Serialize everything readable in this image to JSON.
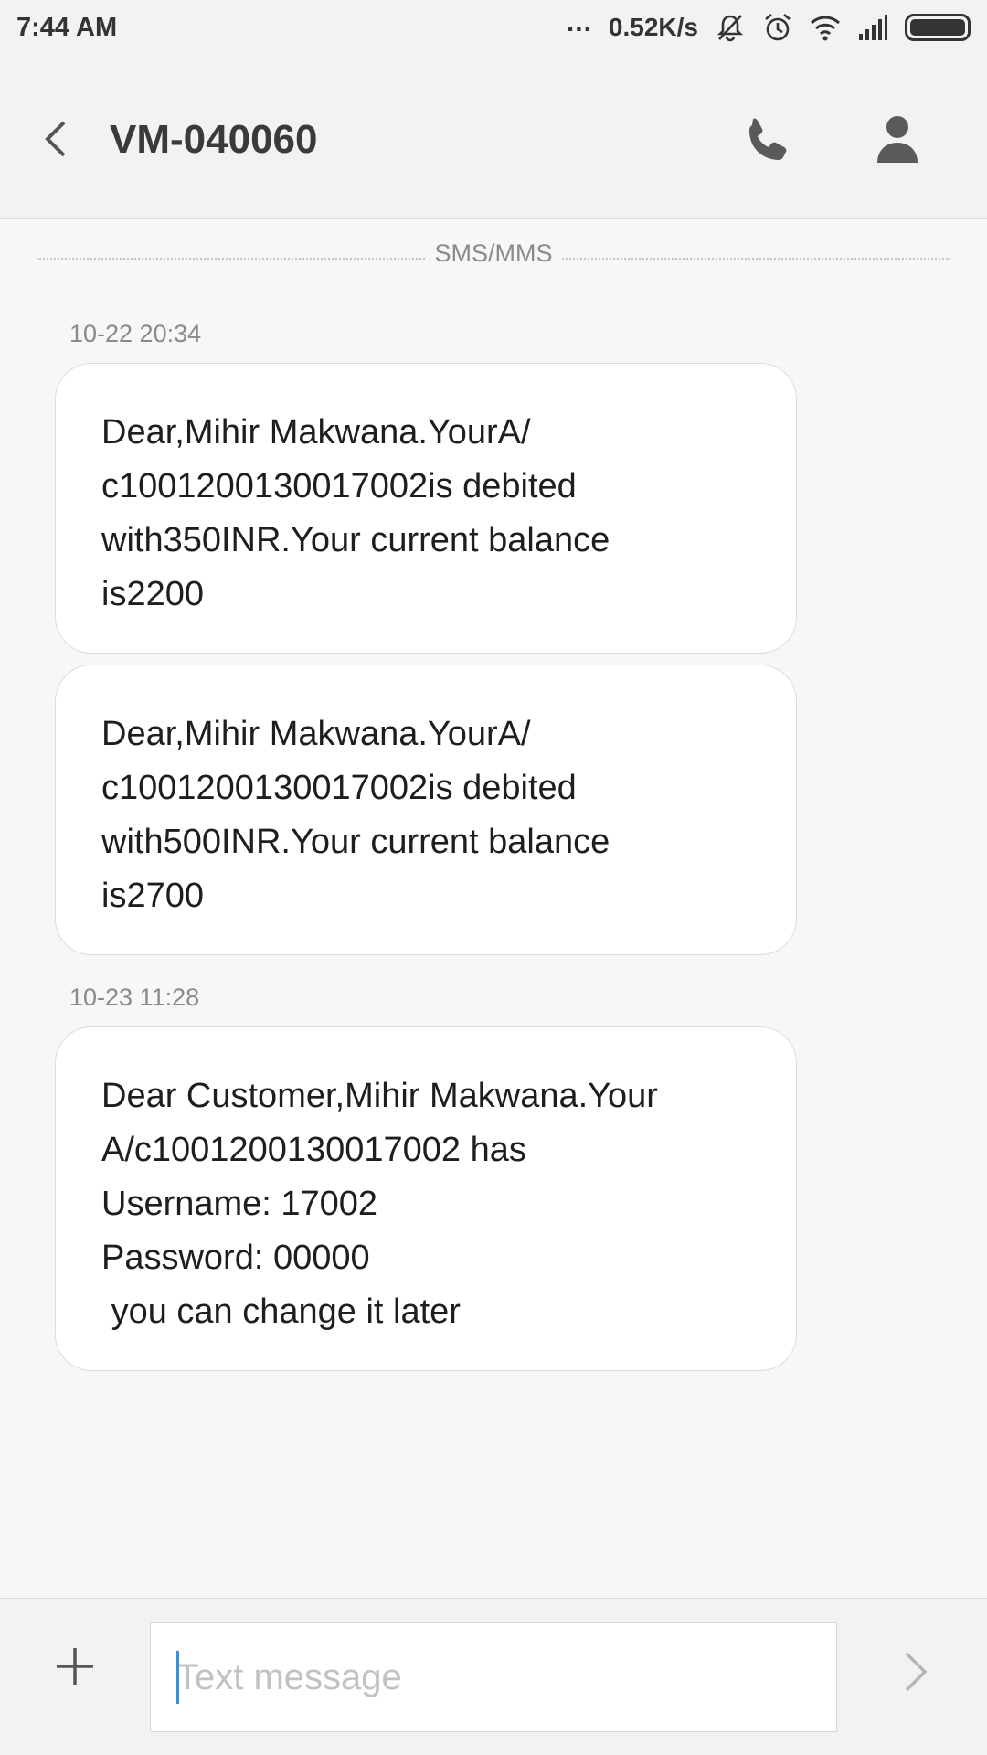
{
  "status_bar": {
    "time": "7:44 AM",
    "dots": "...",
    "speed": "0.52K/s",
    "battery_level": 1.0
  },
  "header": {
    "title": "VM-040060"
  },
  "conversation": {
    "channel_label": "SMS/MMS",
    "groups": [
      {
        "timestamp": "10-22 20:34",
        "messages": [
          "Dear,Mihir Makwana.YourA/\nc1001200130017002is debited\nwith350INR.Your current balance\nis2200",
          "Dear,Mihir Makwana.YourA/\nc1001200130017002is debited\nwith500INR.Your current balance\nis2700"
        ]
      },
      {
        "timestamp": "10-23 11:28",
        "messages": [
          "Dear Customer,Mihir Makwana.Your\nA/c1001200130017002 has\nUsername: 17002\nPassword: 00000\n you can change it later"
        ]
      }
    ]
  },
  "composer": {
    "placeholder": "Text message",
    "value": ""
  },
  "icons": {
    "back": "chevron-left-icon",
    "call": "phone-icon",
    "contact": "person-icon",
    "add": "plus-icon",
    "send": "chevron-right-icon"
  }
}
